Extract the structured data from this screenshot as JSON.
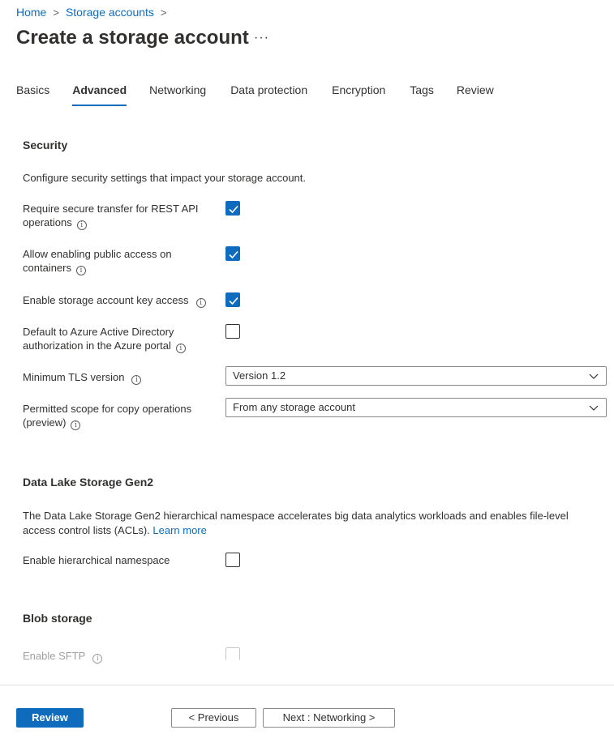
{
  "breadcrumb": {
    "items": [
      "Home",
      "Storage accounts"
    ],
    "sep": ">"
  },
  "page": {
    "title": "Create a storage account",
    "more": "···"
  },
  "tabs": [
    {
      "label": "Basics",
      "active": false
    },
    {
      "label": "Advanced",
      "active": true
    },
    {
      "label": "Networking",
      "active": false
    },
    {
      "label": "Data protection",
      "active": false
    },
    {
      "label": "Encryption",
      "active": false
    },
    {
      "label": "Tags",
      "active": false
    },
    {
      "label": "Review",
      "active": false
    }
  ],
  "security": {
    "heading": "Security",
    "description": "Configure security settings that impact your storage account.",
    "secure_transfer": {
      "label": "Require secure transfer for REST API operations",
      "checked": true
    },
    "public_access": {
      "label": "Allow enabling public access on containers",
      "checked": true
    },
    "key_access": {
      "label": "Enable storage account key access",
      "checked": true
    },
    "aad_default": {
      "label": "Default to Azure Active Directory authorization in the Azure portal",
      "checked": false
    },
    "tls": {
      "label": "Minimum TLS version",
      "value": "Version 1.2"
    },
    "copy_scope": {
      "label": "Permitted scope for copy operations (preview)",
      "value": "From any storage account"
    }
  },
  "datalake": {
    "heading": "Data Lake Storage Gen2",
    "description": "The Data Lake Storage Gen2 hierarchical namespace accelerates big data analytics workloads and enables file-level access control lists (ACLs).",
    "learn_more": "Learn more",
    "hierarchical": {
      "label": "Enable hierarchical namespace",
      "checked": false
    }
  },
  "blob": {
    "heading": "Blob storage",
    "sftp": {
      "label": "Enable SFTP",
      "checked": false,
      "disabled": true
    }
  },
  "footer": {
    "review": "Review",
    "previous": "< Previous",
    "next": "Next : Networking >"
  },
  "icons": {
    "info": "i"
  },
  "colors": {
    "accent": "#0f6cbd",
    "text": "#323130"
  }
}
